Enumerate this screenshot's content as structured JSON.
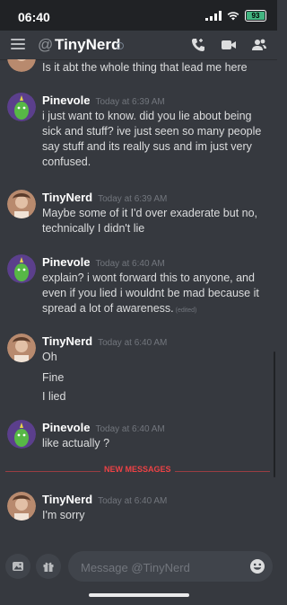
{
  "status_bar": {
    "time": "06:40",
    "battery_level": "93",
    "battery_color": "#43b581"
  },
  "header": {
    "at_symbol": "@",
    "channel_name": "TinyNerd",
    "icons": [
      "hamburger-icon",
      "call-icon",
      "video-icon",
      "members-icon"
    ]
  },
  "messages": [
    {
      "type": "continuation",
      "text": "Is it abt the whole thing that lead me here"
    },
    {
      "author": "Pinevole",
      "timestamp": "Today at 6:39 AM",
      "lines": [
        "i just want to know. did you lie about being sick and stuff? ive just seen so many people say stuff and its really sus and im just very confused."
      ],
      "edited": ""
    },
    {
      "author": "TinyNerd",
      "timestamp": "Today at 6:39 AM",
      "lines": [
        "Maybe some of it I'd over exaderate but no, technically I didn't lie"
      ],
      "edited": ""
    },
    {
      "author": "Pinevole",
      "timestamp": "Today at 6:40 AM",
      "lines": [
        "explain? i wont forward this to anyone, and even if you lied i wouldnt be mad because it spread a lot of awareness."
      ],
      "edited": "(edited)"
    },
    {
      "author": "TinyNerd",
      "timestamp": "Today at 6:40 AM",
      "lines": [
        "Oh",
        "Fine",
        "I lied"
      ],
      "edited": ""
    },
    {
      "author": "Pinevole",
      "timestamp": "Today at 6:40 AM",
      "lines": [
        "like actually ?"
      ],
      "edited": ""
    },
    {
      "author": "TinyNerd",
      "timestamp": "Today at 6:40 AM",
      "lines": [
        "I'm sorry"
      ],
      "edited": ""
    }
  ],
  "divider": {
    "label": "NEW MESSAGES",
    "color": "#ed4245"
  },
  "composer": {
    "placeholder": "Message @TinyNerd",
    "icons": [
      "image-icon",
      "gift-icon",
      "emoji-icon"
    ]
  },
  "colors": {
    "background": "#36393f",
    "username": "#ffffff",
    "timestamp": "#72767d",
    "message_text": "#dcddde"
  }
}
